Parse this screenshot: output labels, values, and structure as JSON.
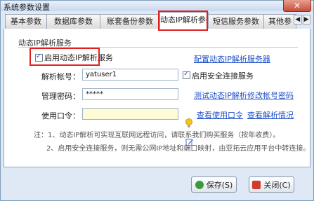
{
  "window": {
    "title": "系统参数设置",
    "close_glyph": "✕"
  },
  "tabs": [
    {
      "label": "基本参数"
    },
    {
      "label": "数据库参数"
    },
    {
      "label": "账套备份参数"
    },
    {
      "label": "动态IP解析参数"
    },
    {
      "label": "短信服务参数"
    },
    {
      "label": "其他参"
    }
  ],
  "tab_nav": {
    "prev": "◀",
    "next": "▶"
  },
  "section": {
    "title": "动态IP解析服务",
    "enable_label": "启用动态IP解析服务",
    "configure_link": "配置动态IP解析服务器",
    "account_label": "解析帐号：",
    "account_value": "yatuser1",
    "secure_label": "启用安全连接服务",
    "password_label": "管理密码：",
    "password_value": "*****",
    "test_link": "测试动态IP解析",
    "modify_link": "修改帐号密码",
    "token_label": "使用口令：",
    "token_value": "",
    "view_token_link": "查看使用口令",
    "view_result_link": "查看解析情况"
  },
  "notes": {
    "line1": "注：1、动态IP解析可实现互联网远程访问，请联系我们购买服务（按年收费）。",
    "line2": "2、启用安全连接服务，则无需公网IP地址和端口映射，由亚拓云应用平台中转连接。"
  },
  "buttons": {
    "save": "保存(S)",
    "close": "关闭(C)"
  },
  "colors": {
    "accent": "#e02020",
    "link": "#2150c9"
  }
}
